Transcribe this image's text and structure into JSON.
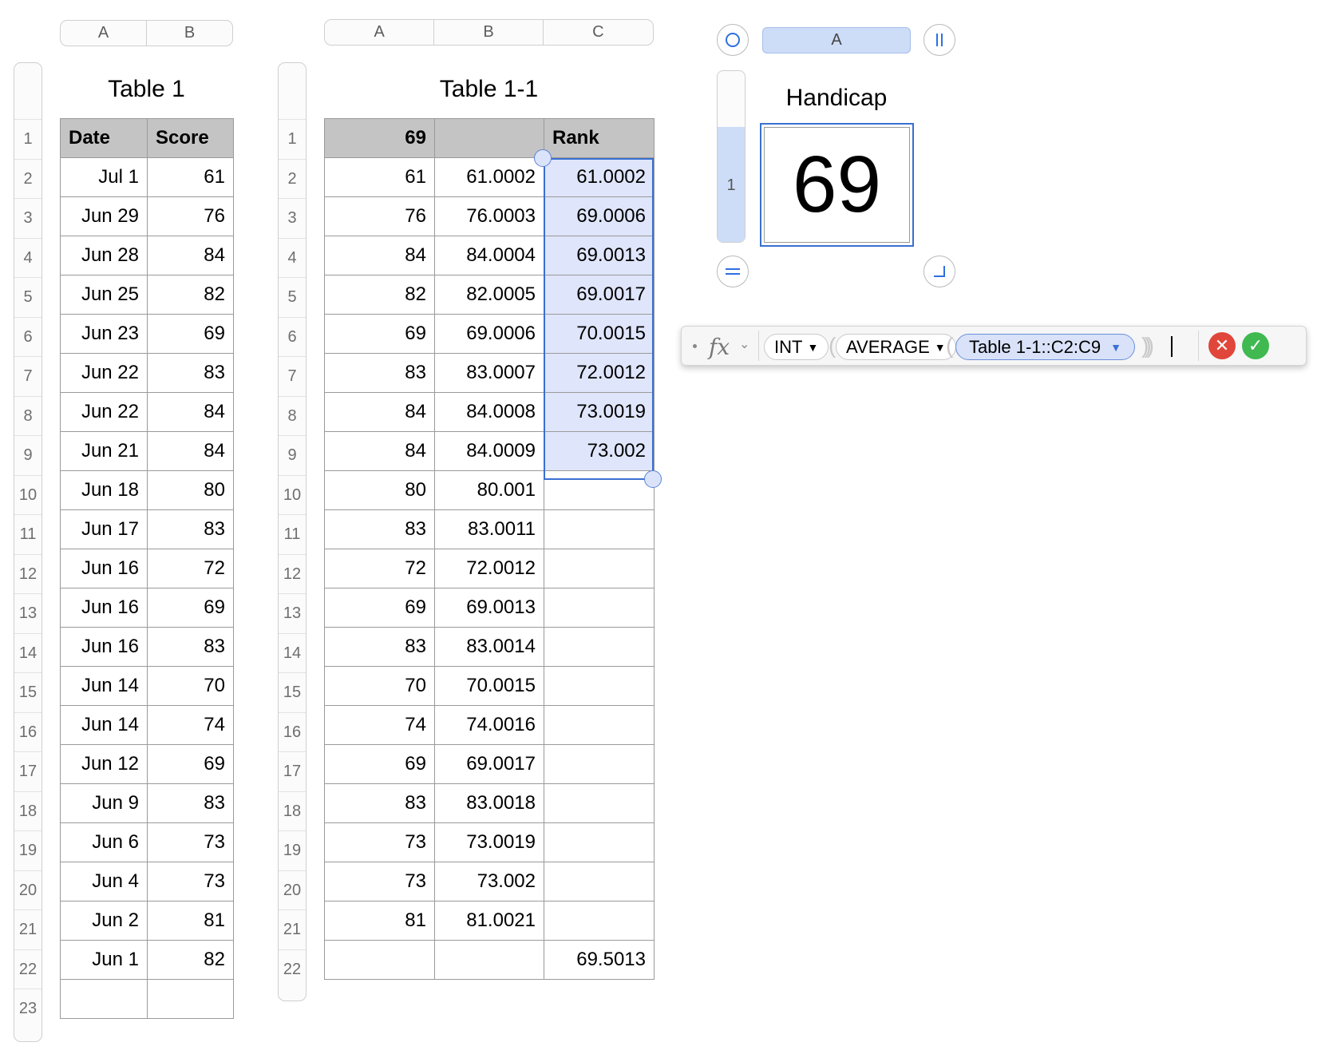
{
  "table1": {
    "columns": [
      "A",
      "B"
    ],
    "title": "Table 1",
    "headers": [
      "Date",
      "Score"
    ],
    "row_numbers": [
      "1",
      "2",
      "3",
      "4",
      "5",
      "6",
      "7",
      "8",
      "9",
      "10",
      "11",
      "12",
      "13",
      "14",
      "15",
      "16",
      "17",
      "18",
      "19",
      "20",
      "21",
      "22",
      "23"
    ],
    "rows": [
      [
        "Jul 1",
        "61"
      ],
      [
        "Jun 29",
        "76"
      ],
      [
        "Jun 28",
        "84"
      ],
      [
        "Jun 25",
        "82"
      ],
      [
        "Jun 23",
        "69"
      ],
      [
        "Jun 22",
        "83"
      ],
      [
        "Jun 22",
        "84"
      ],
      [
        "Jun 21",
        "84"
      ],
      [
        "Jun 18",
        "80"
      ],
      [
        "Jun 17",
        "83"
      ],
      [
        "Jun 16",
        "72"
      ],
      [
        "Jun 16",
        "69"
      ],
      [
        "Jun 16",
        "83"
      ],
      [
        "Jun 14",
        "70"
      ],
      [
        "Jun 14",
        "74"
      ],
      [
        "Jun 12",
        "69"
      ],
      [
        "Jun 9",
        "83"
      ],
      [
        "Jun 6",
        "73"
      ],
      [
        "Jun 4",
        "73"
      ],
      [
        "Jun 2",
        "81"
      ],
      [
        "Jun 1",
        "82"
      ],
      [
        "",
        ""
      ]
    ]
  },
  "table2": {
    "columns": [
      "A",
      "B",
      "C"
    ],
    "title": "Table 1-1",
    "headers": [
      "69",
      "",
      "Rank"
    ],
    "row_numbers": [
      "1",
      "2",
      "3",
      "4",
      "5",
      "6",
      "7",
      "8",
      "9",
      "10",
      "11",
      "12",
      "13",
      "14",
      "15",
      "16",
      "17",
      "18",
      "19",
      "20",
      "21",
      "22"
    ],
    "rows": [
      [
        "61",
        "61.0002",
        "61.0002"
      ],
      [
        "76",
        "76.0003",
        "69.0006"
      ],
      [
        "84",
        "84.0004",
        "69.0013"
      ],
      [
        "82",
        "82.0005",
        "69.0017"
      ],
      [
        "69",
        "69.0006",
        "70.0015"
      ],
      [
        "83",
        "83.0007",
        "72.0012"
      ],
      [
        "84",
        "84.0008",
        "73.0019"
      ],
      [
        "84",
        "84.0009",
        "73.002"
      ],
      [
        "80",
        "80.001",
        ""
      ],
      [
        "83",
        "83.0011",
        ""
      ],
      [
        "72",
        "72.0012",
        ""
      ],
      [
        "69",
        "69.0013",
        ""
      ],
      [
        "83",
        "83.0014",
        ""
      ],
      [
        "70",
        "70.0015",
        ""
      ],
      [
        "74",
        "74.0016",
        ""
      ],
      [
        "69",
        "69.0017",
        ""
      ],
      [
        "83",
        "83.0018",
        ""
      ],
      [
        "73",
        "73.0019",
        ""
      ],
      [
        "73",
        "73.002",
        ""
      ],
      [
        "81",
        "81.0021",
        ""
      ],
      [
        "",
        "",
        "69.5013"
      ]
    ]
  },
  "handicap": {
    "column": "A",
    "row_number": "1",
    "title": "Handicap",
    "value": "69"
  },
  "formula_bar": {
    "fx_label": "fx",
    "func1": "INT",
    "func2": "AVERAGE",
    "reference": "Table 1-1::C2:C9"
  },
  "colors": {
    "selection": "#3a6fd1",
    "selection_fill": "#dfe5fa",
    "header_fill": "#c4c4c4",
    "cancel": "#e0463a",
    "accept": "#3fb950"
  }
}
